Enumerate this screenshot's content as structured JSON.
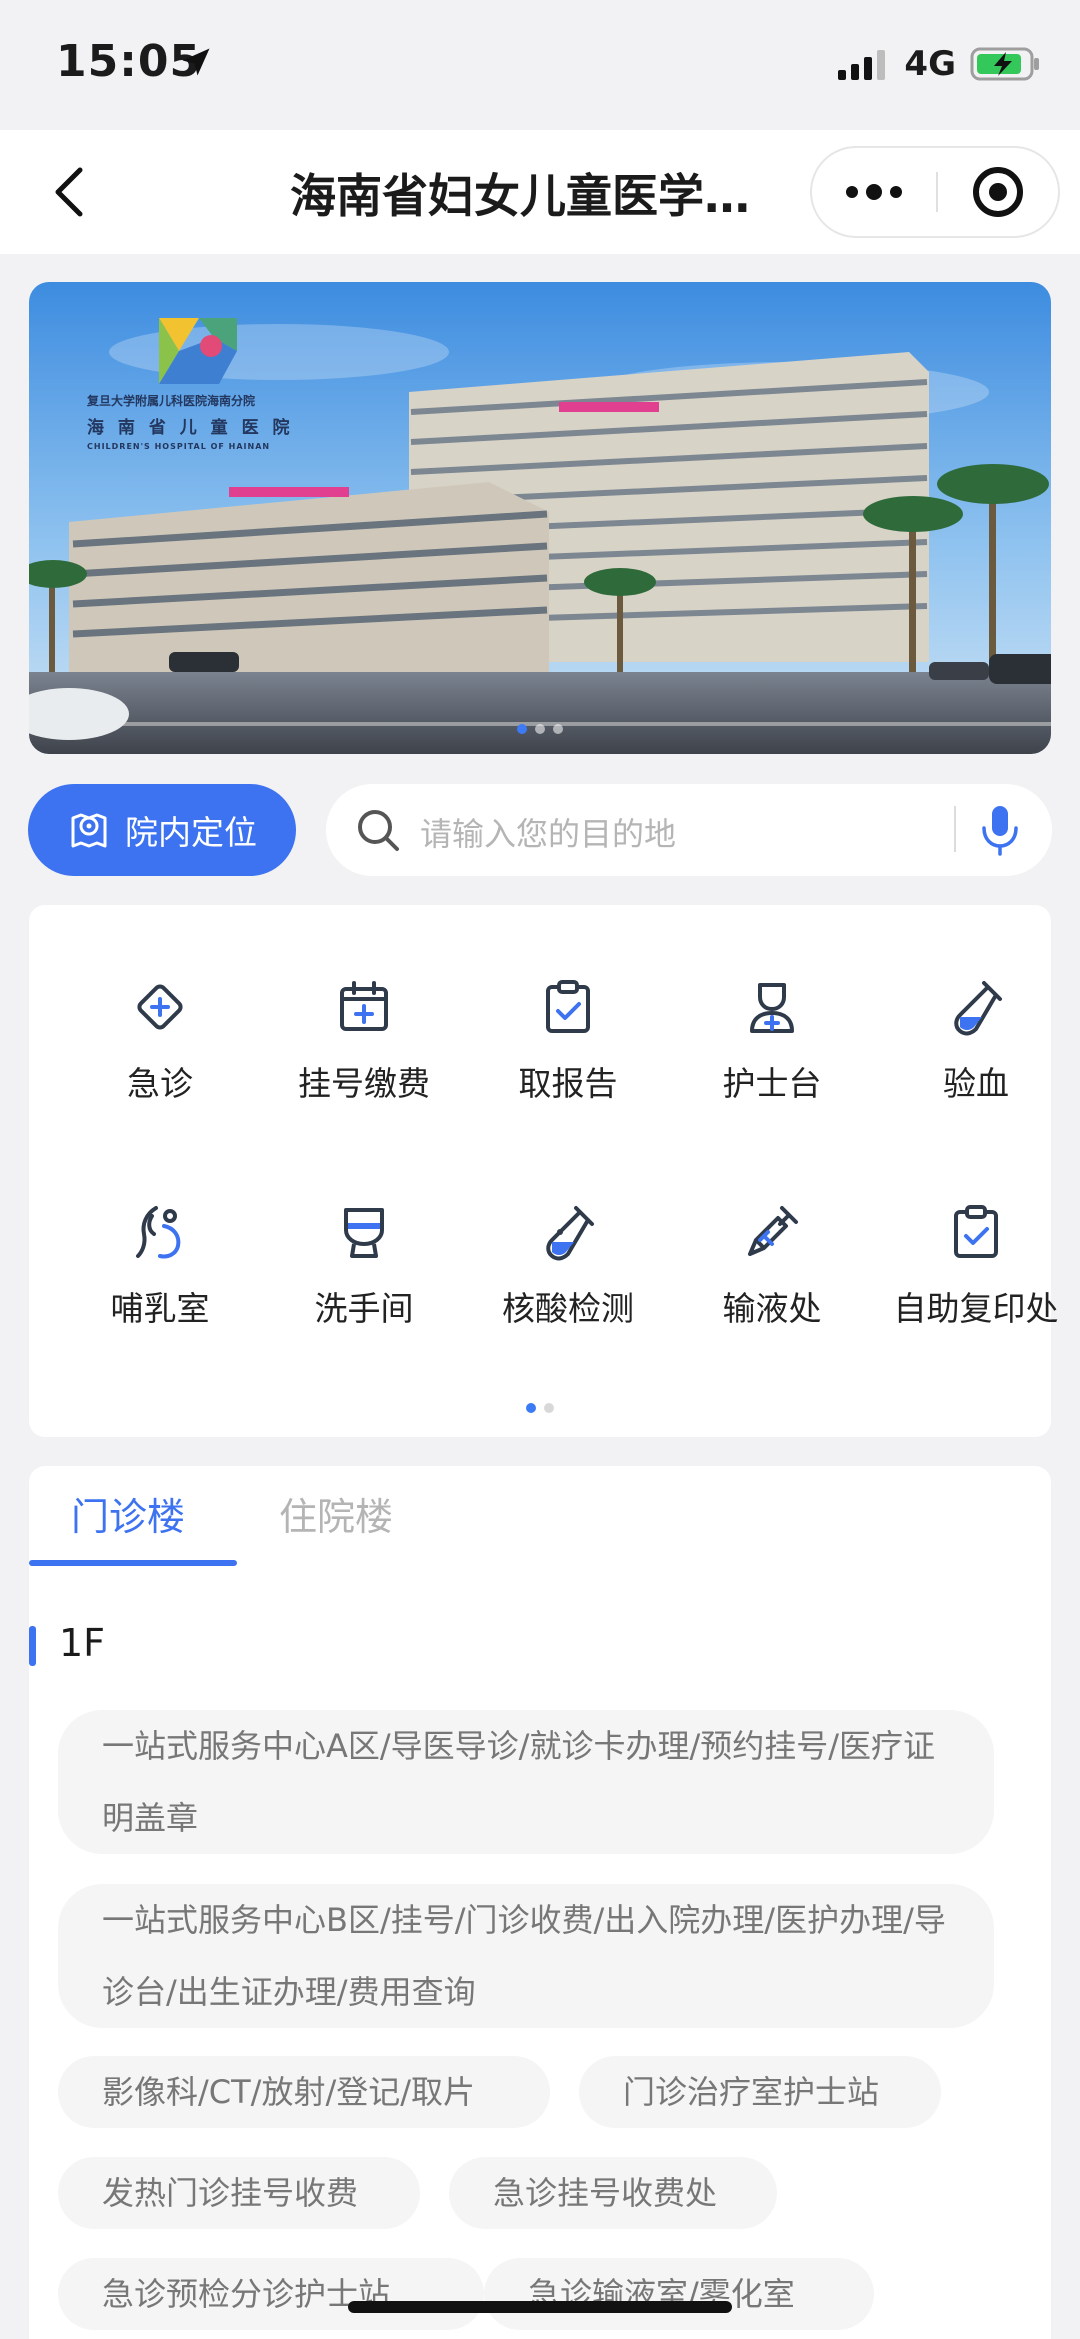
{
  "status_bar": {
    "time": "15:05",
    "network": "4G"
  },
  "nav": {
    "title": "海南省妇女儿童医学…"
  },
  "banner": {
    "logo_line1": "复旦大学附属儿科医院海南分院",
    "logo_line2": "海 南 省 儿 童 医 院",
    "logo_line3": "CHILDREN'S HOSPITAL OF HAINAN"
  },
  "locate": {
    "label": "院内定位"
  },
  "search": {
    "placeholder": "请输入您的目的地"
  },
  "quick_grid": {
    "items": [
      {
        "label": "急诊",
        "icon": "emergency-icon"
      },
      {
        "label": "挂号缴费",
        "icon": "calendar-plus-icon"
      },
      {
        "label": "取报告",
        "icon": "clipboard-check-icon"
      },
      {
        "label": "护士台",
        "icon": "nurse-icon"
      },
      {
        "label": "验血",
        "icon": "test-tube-icon"
      },
      {
        "label": "哺乳室",
        "icon": "breastfeeding-icon"
      },
      {
        "label": "洗手间",
        "icon": "toilet-icon"
      },
      {
        "label": "核酸检测",
        "icon": "nucleic-test-icon"
      },
      {
        "label": "输液处",
        "icon": "syringe-icon"
      },
      {
        "label": "自助复印处",
        "icon": "copy-clipboard-icon"
      }
    ]
  },
  "tabs": {
    "active": "门诊楼",
    "inactive": "住院楼"
  },
  "floor": {
    "label": "1F",
    "chips": [
      "一站式服务中心A区/导医导诊/就诊卡办理/预约挂号/医疗证明盖章",
      "一站式服务中心B区/挂号/门诊收费/出入院办理/医护办理/导诊台/出生证办理/费用查询",
      "影像科/CT/放射/登记/取片",
      "门诊治疗室护士站",
      "发热门诊挂号收费",
      "急诊挂号收费处",
      "急诊预检分诊护士站",
      "急诊输液室/雾化室"
    ]
  },
  "colors": {
    "accent": "#3d73f0",
    "background": "#f2f2f4"
  }
}
